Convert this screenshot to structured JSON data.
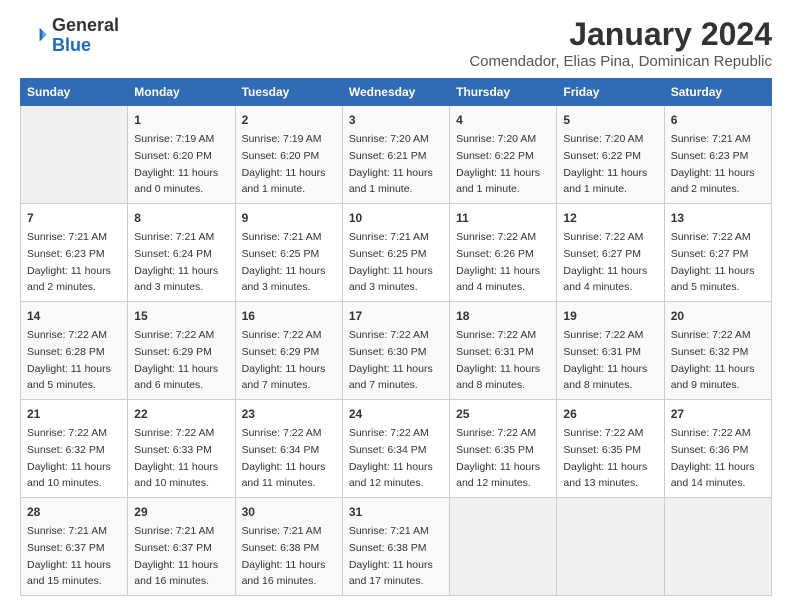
{
  "logo": {
    "text_general": "General",
    "text_blue": "Blue"
  },
  "header": {
    "month": "January 2024",
    "location": "Comendador, Elias Pina, Dominican Republic"
  },
  "days_of_week": [
    "Sunday",
    "Monday",
    "Tuesday",
    "Wednesday",
    "Thursday",
    "Friday",
    "Saturday"
  ],
  "weeks": [
    [
      {
        "day": "",
        "sunrise": "",
        "sunset": "",
        "daylight": ""
      },
      {
        "day": "1",
        "sunrise": "Sunrise: 7:19 AM",
        "sunset": "Sunset: 6:20 PM",
        "daylight": "Daylight: 11 hours and 0 minutes."
      },
      {
        "day": "2",
        "sunrise": "Sunrise: 7:19 AM",
        "sunset": "Sunset: 6:20 PM",
        "daylight": "Daylight: 11 hours and 1 minute."
      },
      {
        "day": "3",
        "sunrise": "Sunrise: 7:20 AM",
        "sunset": "Sunset: 6:21 PM",
        "daylight": "Daylight: 11 hours and 1 minute."
      },
      {
        "day": "4",
        "sunrise": "Sunrise: 7:20 AM",
        "sunset": "Sunset: 6:22 PM",
        "daylight": "Daylight: 11 hours and 1 minute."
      },
      {
        "day": "5",
        "sunrise": "Sunrise: 7:20 AM",
        "sunset": "Sunset: 6:22 PM",
        "daylight": "Daylight: 11 hours and 1 minute."
      },
      {
        "day": "6",
        "sunrise": "Sunrise: 7:21 AM",
        "sunset": "Sunset: 6:23 PM",
        "daylight": "Daylight: 11 hours and 2 minutes."
      }
    ],
    [
      {
        "day": "7",
        "sunrise": "Sunrise: 7:21 AM",
        "sunset": "Sunset: 6:23 PM",
        "daylight": "Daylight: 11 hours and 2 minutes."
      },
      {
        "day": "8",
        "sunrise": "Sunrise: 7:21 AM",
        "sunset": "Sunset: 6:24 PM",
        "daylight": "Daylight: 11 hours and 3 minutes."
      },
      {
        "day": "9",
        "sunrise": "Sunrise: 7:21 AM",
        "sunset": "Sunset: 6:25 PM",
        "daylight": "Daylight: 11 hours and 3 minutes."
      },
      {
        "day": "10",
        "sunrise": "Sunrise: 7:21 AM",
        "sunset": "Sunset: 6:25 PM",
        "daylight": "Daylight: 11 hours and 3 minutes."
      },
      {
        "day": "11",
        "sunrise": "Sunrise: 7:22 AM",
        "sunset": "Sunset: 6:26 PM",
        "daylight": "Daylight: 11 hours and 4 minutes."
      },
      {
        "day": "12",
        "sunrise": "Sunrise: 7:22 AM",
        "sunset": "Sunset: 6:27 PM",
        "daylight": "Daylight: 11 hours and 4 minutes."
      },
      {
        "day": "13",
        "sunrise": "Sunrise: 7:22 AM",
        "sunset": "Sunset: 6:27 PM",
        "daylight": "Daylight: 11 hours and 5 minutes."
      }
    ],
    [
      {
        "day": "14",
        "sunrise": "Sunrise: 7:22 AM",
        "sunset": "Sunset: 6:28 PM",
        "daylight": "Daylight: 11 hours and 5 minutes."
      },
      {
        "day": "15",
        "sunrise": "Sunrise: 7:22 AM",
        "sunset": "Sunset: 6:29 PM",
        "daylight": "Daylight: 11 hours and 6 minutes."
      },
      {
        "day": "16",
        "sunrise": "Sunrise: 7:22 AM",
        "sunset": "Sunset: 6:29 PM",
        "daylight": "Daylight: 11 hours and 7 minutes."
      },
      {
        "day": "17",
        "sunrise": "Sunrise: 7:22 AM",
        "sunset": "Sunset: 6:30 PM",
        "daylight": "Daylight: 11 hours and 7 minutes."
      },
      {
        "day": "18",
        "sunrise": "Sunrise: 7:22 AM",
        "sunset": "Sunset: 6:31 PM",
        "daylight": "Daylight: 11 hours and 8 minutes."
      },
      {
        "day": "19",
        "sunrise": "Sunrise: 7:22 AM",
        "sunset": "Sunset: 6:31 PM",
        "daylight": "Daylight: 11 hours and 8 minutes."
      },
      {
        "day": "20",
        "sunrise": "Sunrise: 7:22 AM",
        "sunset": "Sunset: 6:32 PM",
        "daylight": "Daylight: 11 hours and 9 minutes."
      }
    ],
    [
      {
        "day": "21",
        "sunrise": "Sunrise: 7:22 AM",
        "sunset": "Sunset: 6:32 PM",
        "daylight": "Daylight: 11 hours and 10 minutes."
      },
      {
        "day": "22",
        "sunrise": "Sunrise: 7:22 AM",
        "sunset": "Sunset: 6:33 PM",
        "daylight": "Daylight: 11 hours and 10 minutes."
      },
      {
        "day": "23",
        "sunrise": "Sunrise: 7:22 AM",
        "sunset": "Sunset: 6:34 PM",
        "daylight": "Daylight: 11 hours and 11 minutes."
      },
      {
        "day": "24",
        "sunrise": "Sunrise: 7:22 AM",
        "sunset": "Sunset: 6:34 PM",
        "daylight": "Daylight: 11 hours and 12 minutes."
      },
      {
        "day": "25",
        "sunrise": "Sunrise: 7:22 AM",
        "sunset": "Sunset: 6:35 PM",
        "daylight": "Daylight: 11 hours and 12 minutes."
      },
      {
        "day": "26",
        "sunrise": "Sunrise: 7:22 AM",
        "sunset": "Sunset: 6:35 PM",
        "daylight": "Daylight: 11 hours and 13 minutes."
      },
      {
        "day": "27",
        "sunrise": "Sunrise: 7:22 AM",
        "sunset": "Sunset: 6:36 PM",
        "daylight": "Daylight: 11 hours and 14 minutes."
      }
    ],
    [
      {
        "day": "28",
        "sunrise": "Sunrise: 7:21 AM",
        "sunset": "Sunset: 6:37 PM",
        "daylight": "Daylight: 11 hours and 15 minutes."
      },
      {
        "day": "29",
        "sunrise": "Sunrise: 7:21 AM",
        "sunset": "Sunset: 6:37 PM",
        "daylight": "Daylight: 11 hours and 16 minutes."
      },
      {
        "day": "30",
        "sunrise": "Sunrise: 7:21 AM",
        "sunset": "Sunset: 6:38 PM",
        "daylight": "Daylight: 11 hours and 16 minutes."
      },
      {
        "day": "31",
        "sunrise": "Sunrise: 7:21 AM",
        "sunset": "Sunset: 6:38 PM",
        "daylight": "Daylight: 11 hours and 17 minutes."
      },
      {
        "day": "",
        "sunrise": "",
        "sunset": "",
        "daylight": ""
      },
      {
        "day": "",
        "sunrise": "",
        "sunset": "",
        "daylight": ""
      },
      {
        "day": "",
        "sunrise": "",
        "sunset": "",
        "daylight": ""
      }
    ]
  ]
}
